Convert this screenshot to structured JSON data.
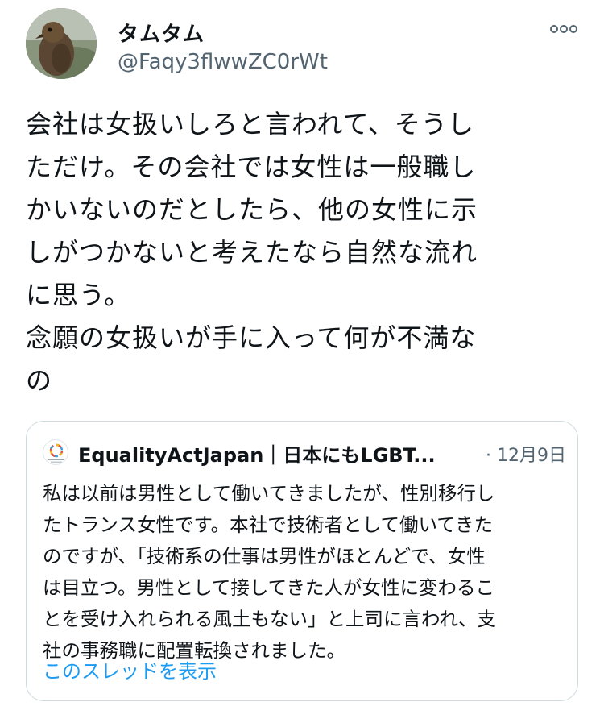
{
  "tweet": {
    "display_name": "タムタム",
    "handle": "@Faqy3flwwZC0rWt",
    "text": "会社は女扱いしろと言われて、そうし\nただけ。その会社では女性は一般職し\nかいないのだとしたら、他の女性に示\nしがつかないと考えたなら自然な流れ\nに思う。\n念願の女扱いが手に入って何が不満な\nの"
  },
  "quoted_tweet": {
    "name": "EqualityActJapan｜日本にもLGBT...",
    "date": "· 12月9日",
    "text": "私は以前は男性として働いてきましたが、性別移行し\nたトランス女性です。本社で技術者として働いてきた\nのですが、「技術系の仕事は男性がほとんどで、女性\nは目立つ。男性として接してきた人が女性に変わるこ\nとを受け入れられる風土もない」と上司に言われ、支\n社の事務職に配置転換されました。",
    "show_thread": "このスレッドを表示"
  },
  "icons": {
    "more": "more-horizontal-icon",
    "avatar": "bird-avatar",
    "quoted_logo": "equality-act-japan-logo"
  },
  "colors": {
    "text": "#0f1419",
    "secondary": "#536471",
    "link": "#1d9bf0",
    "border": "#cfd9de"
  }
}
